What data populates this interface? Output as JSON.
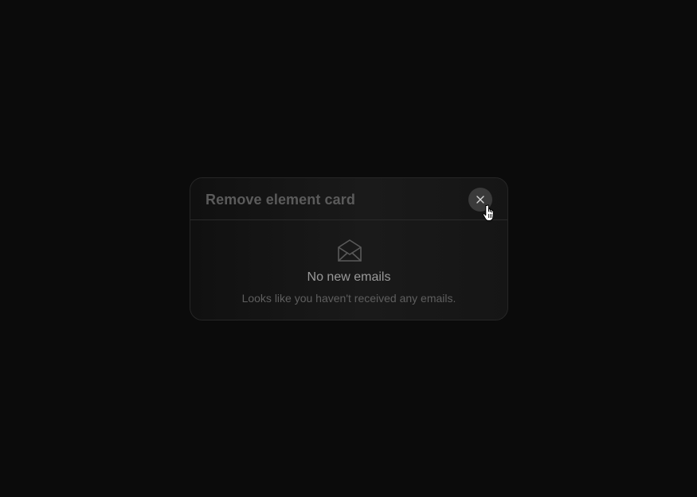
{
  "card": {
    "title": "Remove element card",
    "close_icon": "close-icon",
    "empty_state": {
      "icon": "envelope-open-icon",
      "title": "No new emails",
      "subtitle": "Looks like you haven't received any emails."
    }
  },
  "cursor": {
    "icon": "hand-pointer-icon"
  },
  "colors": {
    "background": "#0b0b0b",
    "card_border": "#262626",
    "close_button": "#3a3a3a",
    "title_text": "#5b5b5b",
    "empty_title_text": "#9a9a9a",
    "empty_subtitle_text": "#5f5f5f"
  }
}
